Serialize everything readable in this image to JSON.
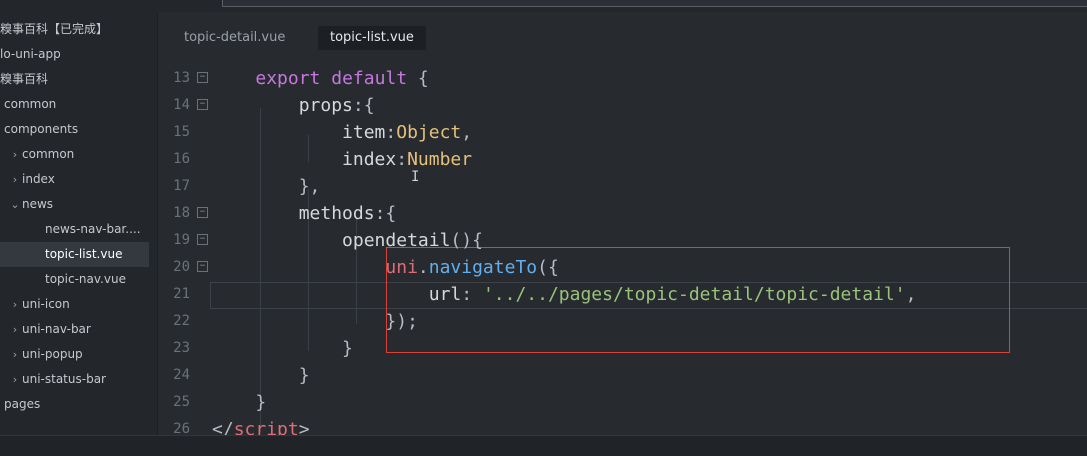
{
  "sidebar": {
    "items": [
      {
        "label": "糗事百科【已完成】",
        "indent": 0,
        "chevron": ""
      },
      {
        "label": "lo-uni-app",
        "indent": 0,
        "chevron": ""
      },
      {
        "label": "糗事百科",
        "indent": 0,
        "chevron": ""
      },
      {
        "label": "common",
        "indent": 0,
        "chevron": ""
      },
      {
        "label": "components",
        "indent": 0,
        "chevron": ""
      },
      {
        "label": "common",
        "indent": 1,
        "chevron": "›"
      },
      {
        "label": "index",
        "indent": 1,
        "chevron": "›"
      },
      {
        "label": "news",
        "indent": 1,
        "chevron": "⌄"
      },
      {
        "label": "news-nav-bar....",
        "indent": 2,
        "chevron": ""
      },
      {
        "label": "topic-list.vue",
        "indent": 2,
        "chevron": "",
        "selected": true
      },
      {
        "label": "topic-nav.vue",
        "indent": 2,
        "chevron": ""
      },
      {
        "label": "uni-icon",
        "indent": 1,
        "chevron": "›"
      },
      {
        "label": "uni-nav-bar",
        "indent": 1,
        "chevron": "›"
      },
      {
        "label": "uni-popup",
        "indent": 1,
        "chevron": "›"
      },
      {
        "label": "uni-status-bar",
        "indent": 1,
        "chevron": "›"
      },
      {
        "label": "pages",
        "indent": 0,
        "chevron": ""
      }
    ]
  },
  "tabs": [
    {
      "label": "topic-detail.vue",
      "active": false
    },
    {
      "label": "topic-list.vue",
      "active": true
    }
  ],
  "editor": {
    "lines": [
      {
        "n": "13",
        "fold": "−",
        "tokens": [
          [
            "    ",
            "punc"
          ],
          [
            "export",
            "kw"
          ],
          [
            " ",
            "punc"
          ],
          [
            "default",
            "kw"
          ],
          [
            " {",
            "punc"
          ]
        ]
      },
      {
        "n": "14",
        "fold": "−",
        "tokens": [
          [
            "        props",
            "prop"
          ],
          [
            ":{",
            "punc"
          ]
        ]
      },
      {
        "n": "15",
        "fold": "",
        "tokens": [
          [
            "            item",
            "prop"
          ],
          [
            ":",
            "punc"
          ],
          [
            "Object",
            "ty"
          ],
          [
            ",",
            "punc"
          ]
        ]
      },
      {
        "n": "16",
        "fold": "",
        "tokens": [
          [
            "            index",
            "prop"
          ],
          [
            ":",
            "punc"
          ],
          [
            "Number",
            "ty"
          ]
        ]
      },
      {
        "n": "17",
        "fold": "",
        "tokens": [
          [
            "        },",
            "punc"
          ]
        ]
      },
      {
        "n": "18",
        "fold": "−",
        "tokens": [
          [
            "        methods",
            "prop"
          ],
          [
            ":{",
            "punc"
          ]
        ]
      },
      {
        "n": "19",
        "fold": "−",
        "tokens": [
          [
            "            opendetail",
            "prop"
          ],
          [
            "(){",
            "punc"
          ]
        ]
      },
      {
        "n": "20",
        "fold": "−",
        "tokens": [
          [
            "                ",
            "punc"
          ],
          [
            "uni",
            "obj"
          ],
          [
            ".",
            "punc"
          ],
          [
            "navigateTo",
            "fn"
          ],
          [
            "({",
            "punc"
          ]
        ]
      },
      {
        "n": "21",
        "fold": "",
        "tokens": [
          [
            "                    url",
            "prop"
          ],
          [
            ": ",
            "punc"
          ],
          [
            "'../../pages/topic-detail/topic-detail'",
            "str"
          ],
          [
            ",",
            "punc"
          ]
        ]
      },
      {
        "n": "22",
        "fold": "",
        "tokens": [
          [
            "                });",
            "punc"
          ]
        ]
      },
      {
        "n": "23",
        "fold": "",
        "tokens": [
          [
            "            }",
            "punc"
          ]
        ]
      },
      {
        "n": "24",
        "fold": "",
        "tokens": [
          [
            "        }",
            "punc"
          ]
        ]
      },
      {
        "n": "25",
        "fold": "",
        "tokens": [
          [
            "    }",
            "punc"
          ]
        ]
      },
      {
        "n": "26",
        "fold": "",
        "tokens": [
          [
            "</",
            "punc"
          ],
          [
            "script",
            "obj"
          ],
          [
            ">",
            "punc"
          ]
        ]
      }
    ]
  }
}
